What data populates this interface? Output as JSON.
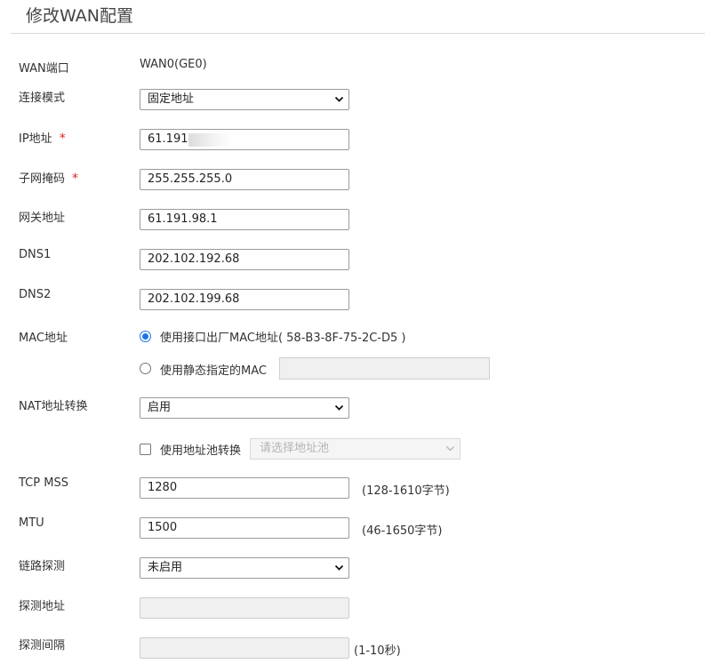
{
  "page": {
    "title": "修改WAN配置"
  },
  "wan_port": {
    "label": "WAN端口",
    "value": "WAN0(GE0)"
  },
  "connect_mode": {
    "label": "连接模式",
    "value": "固定地址"
  },
  "ip": {
    "label": "IP地址",
    "required": "*",
    "value": "61.191.9"
  },
  "mask": {
    "label": "子网掩码",
    "required": "*",
    "value": "255.255.255.0"
  },
  "gateway": {
    "label": "网关地址",
    "value": "61.191.98.1"
  },
  "dns1": {
    "label": "DNS1",
    "value": "202.102.192.68"
  },
  "dns2": {
    "label": "DNS2",
    "value": "202.102.199.68"
  },
  "mac": {
    "label": "MAC地址",
    "option_factory": "使用接口出厂MAC地址( 58-B3-8F-75-2C-D5 )",
    "option_static": "使用静态指定的MAC",
    "selected": "factory",
    "static_value": ""
  },
  "nat": {
    "label": "NAT地址转换",
    "value": "启用",
    "pool_checkbox_label": "使用地址池转换",
    "pool_checked": false,
    "pool_placeholder": "请选择地址池"
  },
  "tcp_mss": {
    "label": "TCP MSS",
    "value": "1280",
    "hint": "(128-1610字节)"
  },
  "mtu": {
    "label": "MTU",
    "value": "1500",
    "hint": "(46-1650字节)"
  },
  "link_detect": {
    "label": "链路探测",
    "value": "未启用"
  },
  "detect_addr": {
    "label": "探测地址",
    "value": ""
  },
  "detect_interval": {
    "label": "探测间隔",
    "value": "",
    "hint": "(1-10秒)"
  },
  "colors": {
    "accent": "#1a73e8",
    "required": "#e02020",
    "divider": "#d9d9d9"
  }
}
